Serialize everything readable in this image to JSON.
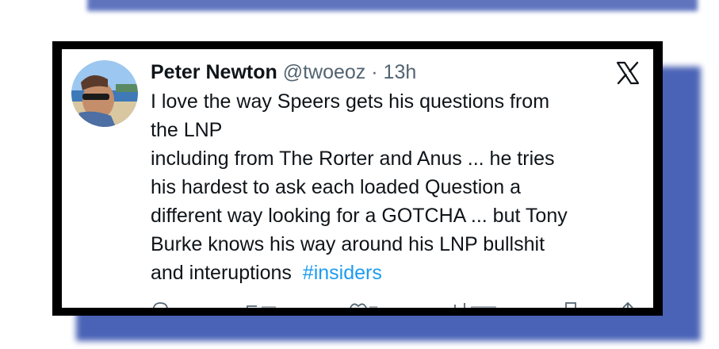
{
  "tweet": {
    "author_name": "Peter Newton",
    "author_handle": "@twoeoz",
    "separator": "·",
    "time": "13h",
    "text_lines": [
      "I love the way Speers gets his questions from",
      "the LNP",
      "including from The Rorter and Anus ... he tries",
      "his hardest to ask each loaded Question a",
      "different way looking for a GOTCHA ... but Tony",
      "Burke knows his way around his LNP bullshit"
    ],
    "last_line_text": "and interuptions  ",
    "hashtag": "#insiders"
  },
  "icons": {
    "platform": "x-logo-icon",
    "avatar": "avatar-photo",
    "actions": [
      "reply-icon",
      "retweet-icon",
      "like-icon",
      "views-icon",
      "bookmark-icon",
      "share-icon"
    ]
  },
  "colors": {
    "text": "#0f1419",
    "muted": "#536471",
    "hashtag": "#1d9bf0",
    "frame": "#000000",
    "shadow": "#4a63b6"
  }
}
